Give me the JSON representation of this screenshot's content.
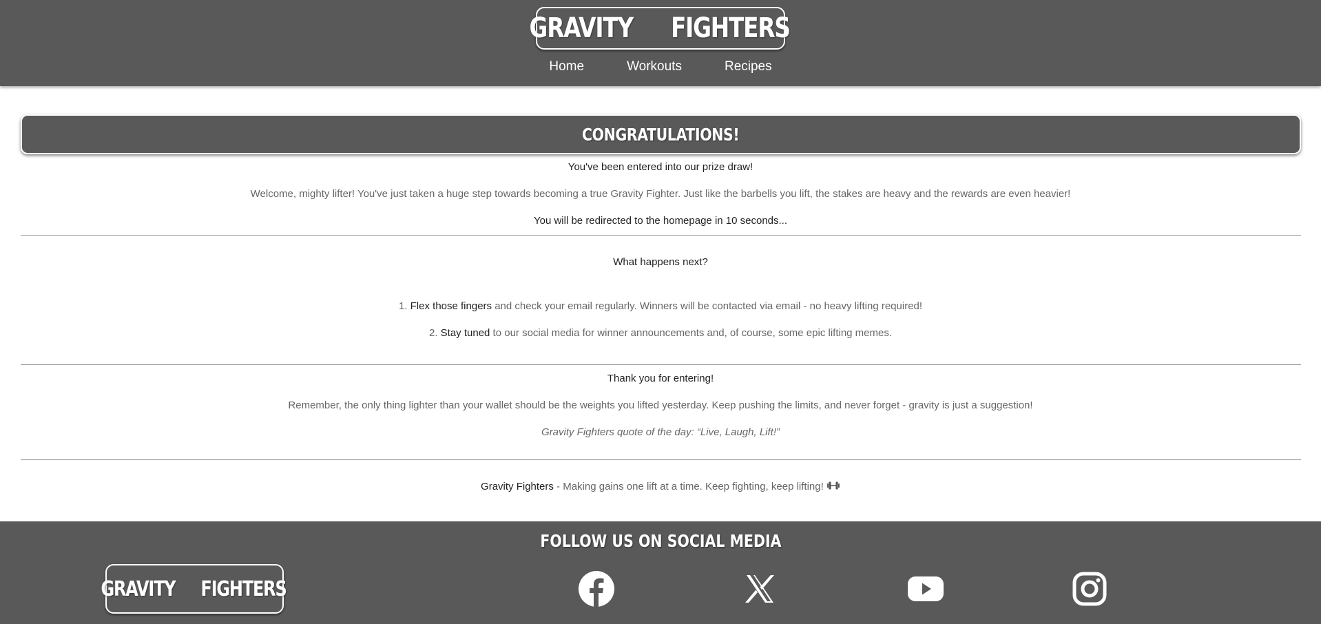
{
  "header": {
    "logo_left": "GRAVITY",
    "logo_right": "FIGHTERS",
    "nav": [
      "Home",
      "Workouts",
      "Recipes"
    ]
  },
  "main": {
    "banner_title": "CONGRATULATIONS!",
    "entered": "You've been entered into our prize draw!",
    "welcome": "Welcome, mighty lifter! You've just taken a huge step towards becoming a true Gravity Fighter. Just like the barbells you lift, the stakes are heavy and the rewards are even heavier!",
    "redirect": "You will be redirected to the homepage in 10 seconds...",
    "next_title": "What happens next?",
    "steps": [
      {
        "num": "1.",
        "bold": "Flex those fingers",
        "rest": " and check your email regularly. Winners will be contacted via email - no heavy lifting required!"
      },
      {
        "num": "2.",
        "bold": "Stay tuned",
        "rest": " to our social media for winner announcements and, of course, some epic lifting memes."
      }
    ],
    "thanks_title": "Thank you for entering!",
    "remember": "Remember, the only thing lighter than your wallet should be the weights you lifted yesterday. Keep pushing the limits, and never forget - gravity is just a suggestion!",
    "quote": "Gravity Fighters quote of the day: “Live, Laugh, Lift!”",
    "tagline_bold": "Gravity Fighters",
    "tagline_rest": " - Making gains one lift at a time. Keep fighting, keep lifting!"
  },
  "footer": {
    "follow_title": "FOLLOW US ON SOCIAL MEDIA",
    "logo_left": "GRAVITY",
    "logo_right": "FIGHTERS",
    "social_icons": [
      "facebook-icon",
      "x-icon",
      "youtube-icon",
      "instagram-icon"
    ]
  },
  "colors": {
    "header_bg": "#595959",
    "text_dark": "#222222",
    "text_light": "#666666"
  }
}
